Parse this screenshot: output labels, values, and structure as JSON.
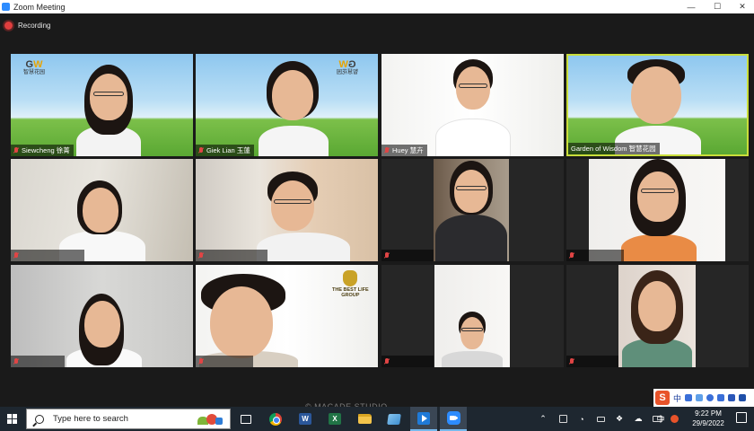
{
  "window": {
    "title": "Zoom Meeting"
  },
  "recording": {
    "label": "Recording"
  },
  "participants": [
    {
      "name": "Siewcheng 徐菁"
    },
    {
      "name": "Giek Lian 玉蓮"
    },
    {
      "name": "Huey 慧卉"
    },
    {
      "name": "Garden of Wisdom 智慧花园"
    }
  ],
  "logos": {
    "gow_text": "智慧花园",
    "tbl_name": "THE BEST LIFE",
    "tbl_sub": "GROUP"
  },
  "watermark": "© MACADE STUDIO",
  "ime": {
    "mode": "中"
  },
  "taskbar": {
    "search_placeholder": "Type here to search",
    "word": "W",
    "excel": "X",
    "lang": "中",
    "time": "9:22 PM",
    "date": "29/9/2022"
  },
  "colors": {
    "active_speaker": "#c9dd3a",
    "zoom_blue": "#2d8cff",
    "muted_mic": "#e04545"
  }
}
